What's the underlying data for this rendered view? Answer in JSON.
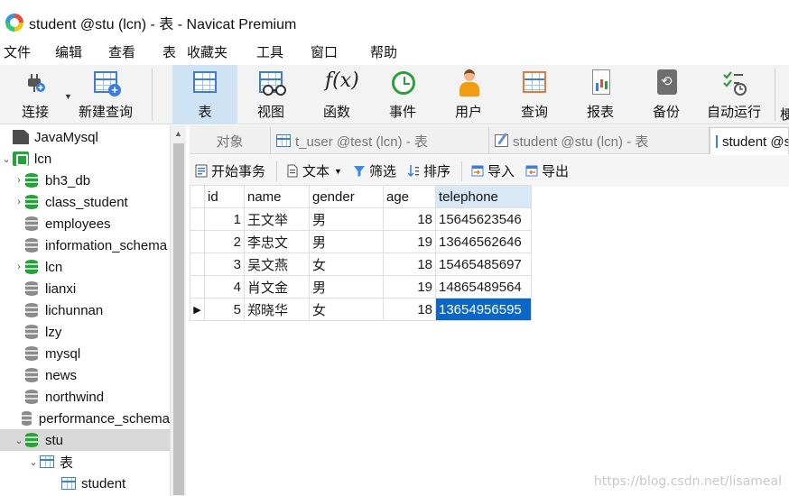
{
  "window": {
    "title": "student @stu (lcn) - 表 - Navicat Premium"
  },
  "menu": [
    "文件",
    "编辑",
    "查看",
    "表",
    "收藏夹",
    "工具",
    "窗口",
    "帮助"
  ],
  "toolbar": {
    "buttons": [
      {
        "label": "连接",
        "icon": "connection-plug-icon"
      },
      {
        "label": "新建查询",
        "icon": "new-query-icon"
      },
      {
        "label": "表",
        "icon": "table-icon",
        "active": true
      },
      {
        "label": "视图",
        "icon": "view-icon"
      },
      {
        "label": "函数",
        "icon": "function-fx-icon"
      },
      {
        "label": "事件",
        "icon": "event-clock-icon"
      },
      {
        "label": "用户",
        "icon": "user-icon"
      },
      {
        "label": "查询",
        "icon": "query-icon"
      },
      {
        "label": "报表",
        "icon": "report-icon"
      },
      {
        "label": "备份",
        "icon": "backup-icon"
      },
      {
        "label": "自动运行",
        "icon": "automation-icon"
      }
    ]
  },
  "sidebar": {
    "items": [
      {
        "label": "JavaMysql",
        "type": "connection",
        "expandable": false
      },
      {
        "label": "lcn",
        "type": "connection-open",
        "expanded": true
      },
      {
        "label": "bh3_db",
        "type": "db-open"
      },
      {
        "label": "class_student",
        "type": "db-open"
      },
      {
        "label": "employees",
        "type": "db"
      },
      {
        "label": "information_schema",
        "type": "db"
      },
      {
        "label": "lcn",
        "type": "db-open"
      },
      {
        "label": "lianxi",
        "type": "db"
      },
      {
        "label": "lichunnan",
        "type": "db"
      },
      {
        "label": "lzy",
        "type": "db"
      },
      {
        "label": "mysql",
        "type": "db"
      },
      {
        "label": "news",
        "type": "db"
      },
      {
        "label": "northwind",
        "type": "db"
      },
      {
        "label": "performance_schema",
        "type": "db"
      },
      {
        "label": "stu",
        "type": "db-open",
        "selected": true
      },
      {
        "label": "表",
        "type": "tables-folder"
      },
      {
        "label": "student",
        "type": "table"
      }
    ]
  },
  "tabs": [
    {
      "label": "对象"
    },
    {
      "label": "t_user @test (lcn) - 表"
    },
    {
      "label": "student @stu (lcn) - 表"
    },
    {
      "label": "student @stu (lcn) - 表",
      "active": true
    }
  ],
  "subtoolbar": {
    "begin_transaction": "开始事务",
    "text": "文本",
    "filter": "筛选",
    "sort": "排序",
    "import": "导入",
    "export": "导出"
  },
  "grid": {
    "columns": [
      "id",
      "name",
      "gender",
      "age",
      "telephone"
    ],
    "rows": [
      [
        "1",
        "王文举",
        "男",
        "18",
        "15645623546"
      ],
      [
        "2",
        "李忠文",
        "男",
        "19",
        "13646562646"
      ],
      [
        "3",
        "吴文燕",
        "女",
        "18",
        "15465485697"
      ],
      [
        "4",
        "肖文金",
        "男",
        "19",
        "14865489564"
      ],
      [
        "5",
        "郑晓华",
        "女",
        "18",
        "13654956595"
      ]
    ],
    "current_row": 5,
    "selected_cell": "13654956595"
  },
  "watermark": "https://blog.csdn.net/lisameal",
  "colors": {
    "accent": "#0a66c7",
    "active_toolbar": "#cfe3f5",
    "db_green": "#27a23b"
  }
}
